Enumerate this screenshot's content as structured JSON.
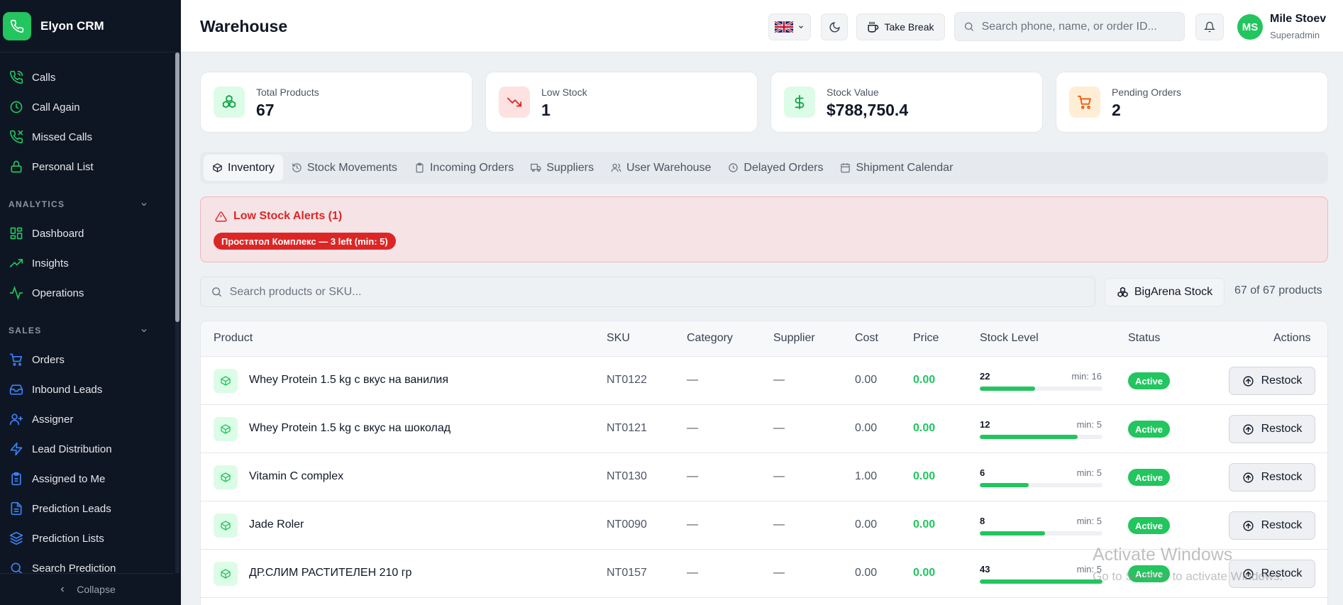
{
  "app": {
    "name": "Elyon CRM"
  },
  "sidebar": {
    "top_items": [
      {
        "label": "Calls",
        "icon": "phone-icon"
      },
      {
        "label": "Call Again",
        "icon": "clock-icon"
      },
      {
        "label": "Missed Calls",
        "icon": "phone-missed-icon"
      },
      {
        "label": "Personal List",
        "icon": "lock-icon"
      }
    ],
    "analytics": {
      "title": "ANALYTICS",
      "items": [
        {
          "label": "Dashboard",
          "icon": "dashboard-icon"
        },
        {
          "label": "Insights",
          "icon": "trending-up-icon"
        },
        {
          "label": "Operations",
          "icon": "activity-icon"
        }
      ]
    },
    "sales": {
      "title": "SALES",
      "items": [
        {
          "label": "Orders",
          "icon": "cart-icon"
        },
        {
          "label": "Inbound Leads",
          "icon": "inbox-icon"
        },
        {
          "label": "Assigner",
          "icon": "user-plus-icon"
        },
        {
          "label": "Lead Distribution",
          "icon": "zap-icon"
        },
        {
          "label": "Assigned to Me",
          "icon": "clipboard-icon"
        },
        {
          "label": "Prediction Leads",
          "icon": "file-icon"
        },
        {
          "label": "Prediction Lists",
          "icon": "layers-icon"
        },
        {
          "label": "Search Prediction",
          "icon": "search-icon"
        }
      ]
    },
    "collapse_label": "Collapse"
  },
  "header": {
    "title": "Warehouse",
    "take_break_label": "Take Break",
    "search_placeholder": "Search phone, name, or order ID...",
    "user": {
      "initials": "MS",
      "name": "Mile Stoev",
      "role": "Superadmin"
    }
  },
  "stats": [
    {
      "label": "Total Products",
      "value": "67",
      "icon": "boxes-icon"
    },
    {
      "label": "Low Stock",
      "value": "1",
      "icon": "trending-down-icon"
    },
    {
      "label": "Stock Value",
      "value": "$788,750.4",
      "icon": "dollar-icon"
    },
    {
      "label": "Pending Orders",
      "value": "2",
      "icon": "cart-icon"
    }
  ],
  "tabs": [
    {
      "label": "Inventory",
      "icon": "package-icon",
      "active": true
    },
    {
      "label": "Stock Movements",
      "icon": "history-icon",
      "active": false
    },
    {
      "label": "Incoming Orders",
      "icon": "clipboard-icon",
      "active": false
    },
    {
      "label": "Suppliers",
      "icon": "truck-icon",
      "active": false
    },
    {
      "label": "User Warehouse",
      "icon": "users-icon",
      "active": false
    },
    {
      "label": "Delayed Orders",
      "icon": "clock-icon",
      "active": false
    },
    {
      "label": "Shipment Calendar",
      "icon": "calendar-icon",
      "active": false
    }
  ],
  "alert": {
    "title": "Low Stock Alerts (1)",
    "chip": "Простатол Комплекс — 3 left (min: 5)"
  },
  "product_search": {
    "placeholder": "Search products or SKU...",
    "stock_source_label": "BigArena Stock",
    "count_label": "67 of 67 products"
  },
  "table": {
    "headers": {
      "product": "Product",
      "sku": "SKU",
      "category": "Category",
      "supplier": "Supplier",
      "cost": "Cost",
      "price": "Price",
      "stock": "Stock Level",
      "status": "Status",
      "actions": "Actions"
    },
    "rows": [
      {
        "name": "Whey Protein 1.5 kg с вкус на ванилия",
        "sku": "NT0122",
        "category": "—",
        "supplier": "—",
        "cost": "0.00",
        "price": "0.00",
        "stock": "22",
        "min": "min: 16",
        "fill": 0.45,
        "status": "Active",
        "action": "Restock"
      },
      {
        "name": "Whey Protein 1.5 kg с вкус на шоколад",
        "sku": "NT0121",
        "category": "—",
        "supplier": "—",
        "cost": "0.00",
        "price": "0.00",
        "stock": "12",
        "min": "min: 5",
        "fill": 0.8,
        "status": "Active",
        "action": "Restock"
      },
      {
        "name": "Vitamin C complex",
        "sku": "NT0130",
        "category": "—",
        "supplier": "—",
        "cost": "1.00",
        "price": "0.00",
        "stock": "6",
        "min": "min: 5",
        "fill": 0.4,
        "status": "Active",
        "action": "Restock"
      },
      {
        "name": "Jade Roler",
        "sku": "NT0090",
        "category": "—",
        "supplier": "—",
        "cost": "0.00",
        "price": "0.00",
        "stock": "8",
        "min": "min: 5",
        "fill": 0.53,
        "status": "Active",
        "action": "Restock"
      },
      {
        "name": "ДР.СЛИМ РАСТИТЕЛЕН 210 гр",
        "sku": "NT0157",
        "category": "—",
        "supplier": "—",
        "cost": "0.00",
        "price": "0.00",
        "stock": "43",
        "min": "min: 5",
        "fill": 1.0,
        "status": "Active",
        "action": "Restock"
      }
    ]
  },
  "watermark": {
    "line1": "Activate Windows",
    "line2": "Go to Settings to activate Windows."
  },
  "colors": {
    "accent": "#22c55e",
    "sidebar_bg": "#0f1623",
    "alert_red": "#dc2626"
  }
}
